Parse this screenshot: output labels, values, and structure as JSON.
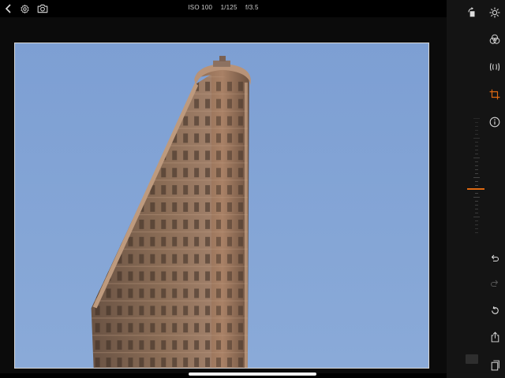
{
  "topbar": {
    "exif": {
      "iso": "ISO 100",
      "shutter": "1/125",
      "aperture": "f/3.5"
    },
    "icons": {
      "back": "chevron-left-icon",
      "settings": "gear-icon",
      "camera": "camera-icon"
    }
  },
  "rightbar": {
    "tools": [
      "rotate-crop-icon",
      "exposure-sun-icon",
      "color-rings-icon",
      "detail-icon",
      "crop-icon",
      "info-icon"
    ],
    "active_tool": "crop-icon",
    "bottom": [
      "undo-icon",
      "redo-icon",
      "reset-icon",
      "share-icon",
      "compare-icon"
    ]
  },
  "colors": {
    "accent": "#e06a12",
    "sky": "#7b9fd2",
    "building": "#8a6a52",
    "chrome": "#141414"
  }
}
